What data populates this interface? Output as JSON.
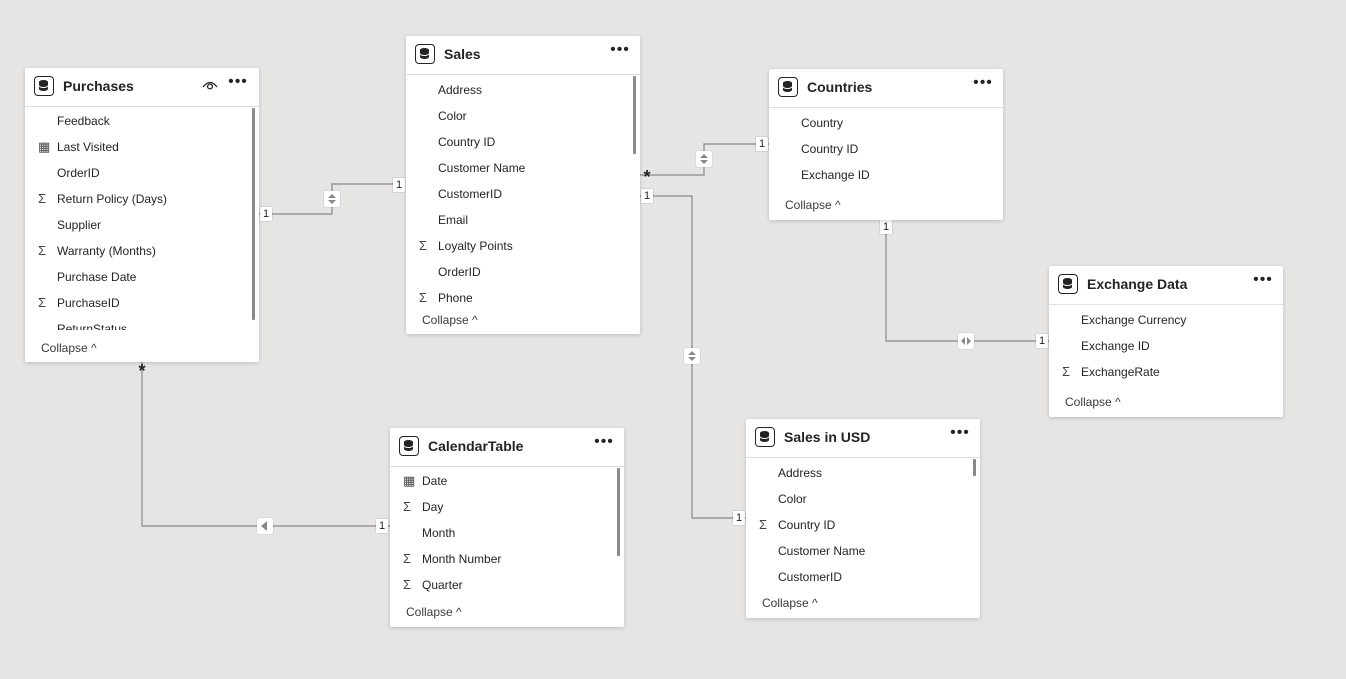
{
  "tables": {
    "purchases": {
      "title": "Purchases",
      "fields": [
        {
          "label": "Feedback",
          "icon": ""
        },
        {
          "label": "Last Visited",
          "icon": "calendar-icon"
        },
        {
          "label": "OrderID",
          "icon": ""
        },
        {
          "label": "Return Policy (Days)",
          "icon": "sigma-icon"
        },
        {
          "label": "Supplier",
          "icon": ""
        },
        {
          "label": "Warranty (Months)",
          "icon": "sigma-icon"
        },
        {
          "label": "Purchase Date",
          "icon": ""
        },
        {
          "label": "PurchaseID",
          "icon": "sigma-icon"
        },
        {
          "label": "ReturnStatus",
          "icon": ""
        }
      ],
      "collapse": "Collapse ^"
    },
    "sales": {
      "title": "Sales",
      "fields": [
        {
          "label": "Address",
          "icon": ""
        },
        {
          "label": "Color",
          "icon": ""
        },
        {
          "label": "Country ID",
          "icon": ""
        },
        {
          "label": "Customer Name",
          "icon": ""
        },
        {
          "label": "CustomerID",
          "icon": ""
        },
        {
          "label": "Email",
          "icon": ""
        },
        {
          "label": "Loyalty Points",
          "icon": "sigma-icon"
        },
        {
          "label": "OrderID",
          "icon": ""
        },
        {
          "label": "Phone",
          "icon": "sigma-icon"
        }
      ],
      "collapse": "Collapse ^"
    },
    "countries": {
      "title": "Countries",
      "fields": [
        {
          "label": "Country",
          "icon": ""
        },
        {
          "label": "Country ID",
          "icon": ""
        },
        {
          "label": "Exchange ID",
          "icon": ""
        }
      ],
      "collapse": "Collapse ^"
    },
    "exchange_data": {
      "title": "Exchange Data",
      "fields": [
        {
          "label": "Exchange Currency",
          "icon": ""
        },
        {
          "label": "Exchange ID",
          "icon": ""
        },
        {
          "label": "ExchangeRate",
          "icon": "sigma-icon"
        }
      ],
      "collapse": "Collapse ^"
    },
    "calendar": {
      "title": "CalendarTable",
      "fields": [
        {
          "label": "Date",
          "icon": "calendar-icon"
        },
        {
          "label": "Day",
          "icon": "sigma-icon"
        },
        {
          "label": "Month",
          "icon": ""
        },
        {
          "label": "Month Number",
          "icon": "sigma-icon"
        },
        {
          "label": "Quarter",
          "icon": "sigma-icon"
        }
      ],
      "collapse": "Collapse ^"
    },
    "sales_usd": {
      "title": "Sales in USD",
      "fields": [
        {
          "label": "Address",
          "icon": ""
        },
        {
          "label": "Color",
          "icon": ""
        },
        {
          "label": "Country ID",
          "icon": "sigma-icon"
        },
        {
          "label": "Customer Name",
          "icon": ""
        },
        {
          "label": "CustomerID",
          "icon": ""
        }
      ],
      "collapse": "Collapse ^"
    }
  },
  "relationships": {
    "purchases_sales": {
      "from_card": "1",
      "to_card": "1"
    },
    "sales_countries": {
      "from_card": "*",
      "to_card": "1"
    },
    "sales_salesusd": {
      "from_card": "1",
      "to_card": "1"
    },
    "countries_exchange": {
      "from_card": "1",
      "to_card": "1"
    },
    "purchases_calendar": {
      "from_card": "*",
      "to_card": "1"
    }
  },
  "colors": {
    "canvas": "#e6e5e4",
    "line": "#8a8886",
    "card": "#ffffff"
  }
}
